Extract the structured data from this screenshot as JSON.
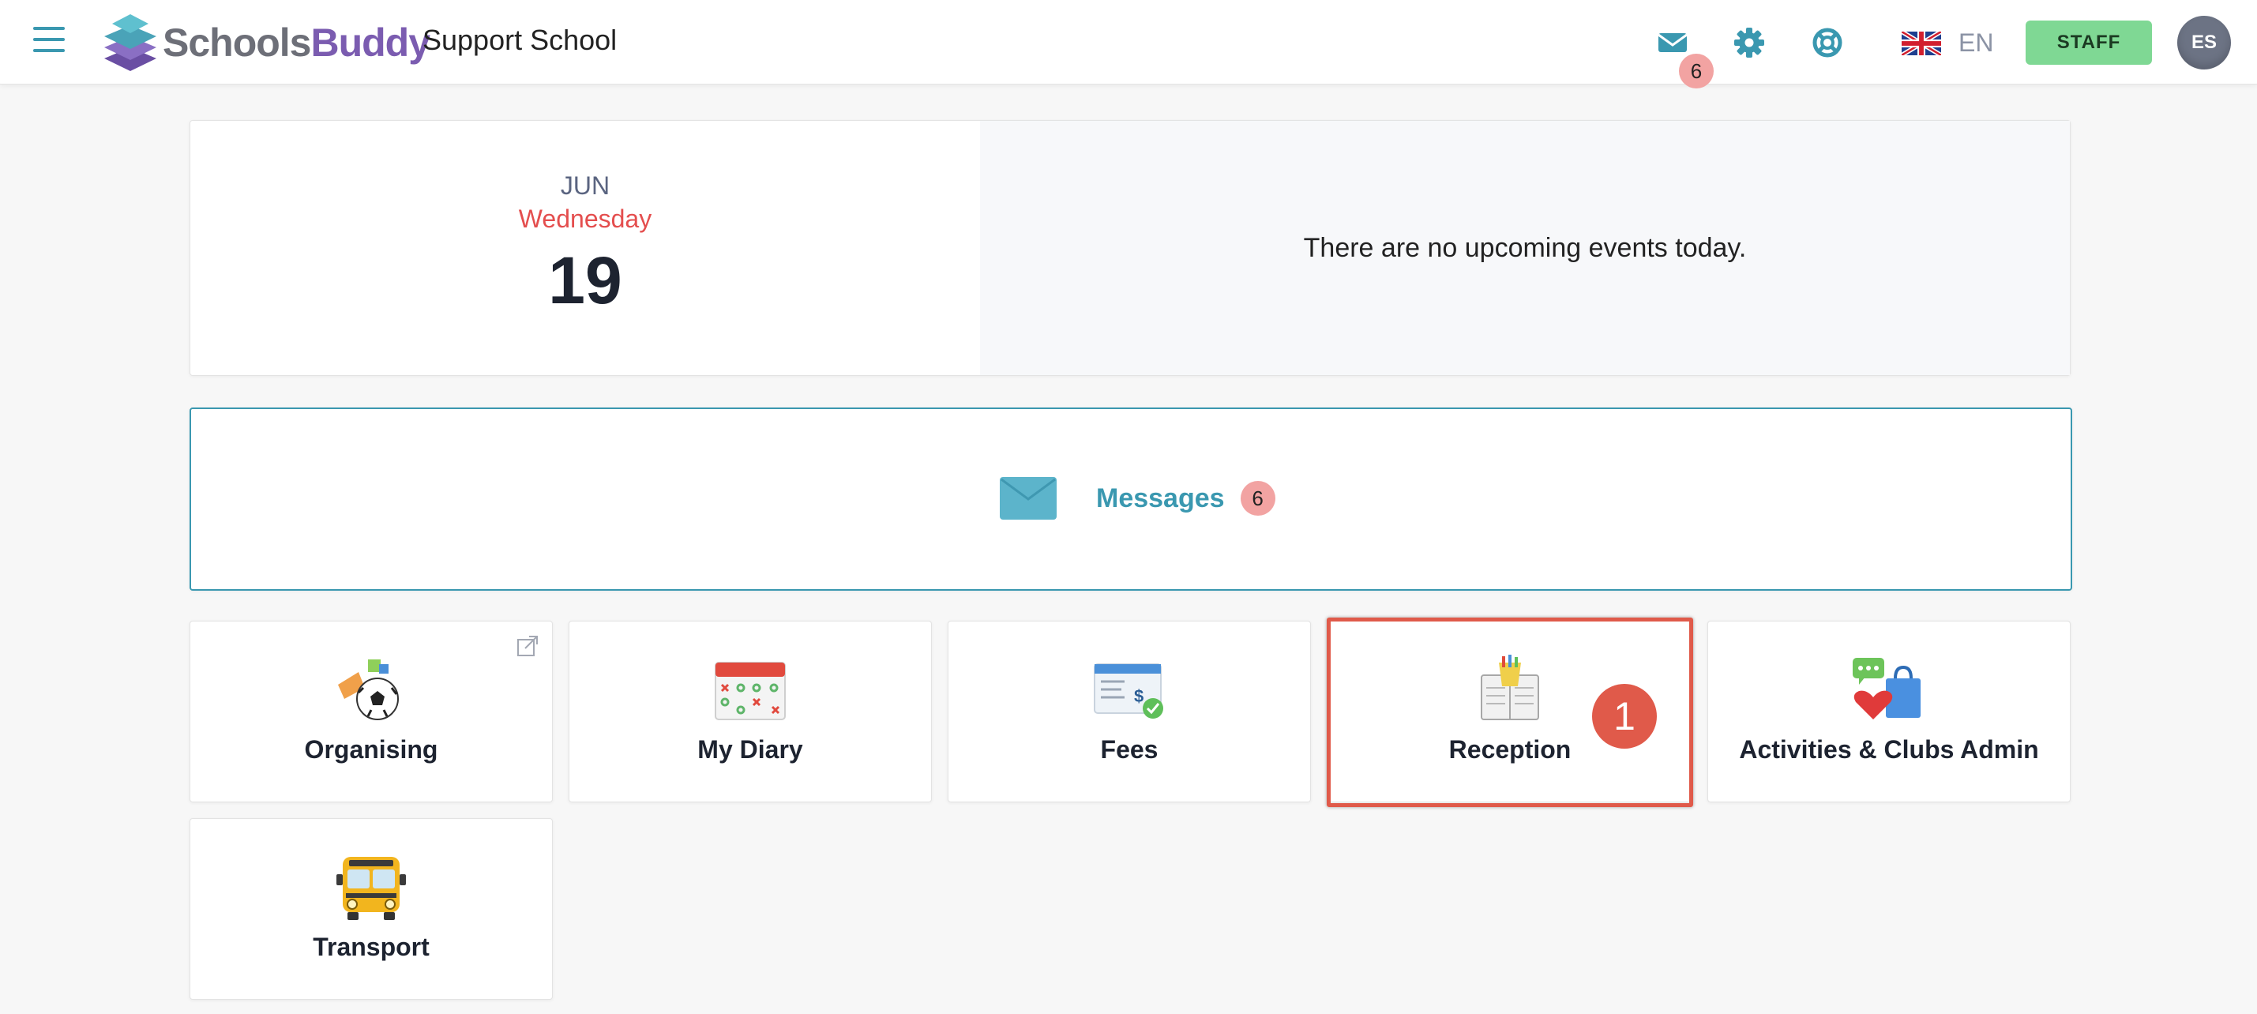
{
  "header": {
    "logo_text_a": "Schools",
    "logo_text_b": "Buddy",
    "school_name": "Support School",
    "mail_badge": "6",
    "language_code": "EN",
    "staff_label": "STAFF",
    "avatar_initials": "ES"
  },
  "date_panel": {
    "month": "JUN",
    "weekday": "Wednesday",
    "day": "19",
    "events_text": "There are no upcoming events today."
  },
  "messages": {
    "label": "Messages",
    "count": "6"
  },
  "tiles": [
    {
      "label": "Organising",
      "icon": "organising-icon"
    },
    {
      "label": "My Diary",
      "icon": "diary-calendar-icon"
    },
    {
      "label": "Fees",
      "icon": "fees-check-icon"
    },
    {
      "label": "Reception",
      "icon": "reception-book-icon"
    },
    {
      "label": "Activities & Clubs Admin",
      "icon": "activities-chat-shopping-icon"
    },
    {
      "label": "Transport",
      "icon": "school-bus-icon"
    }
  ],
  "annotation": {
    "step_number": "1"
  },
  "colors": {
    "accent": "#3a98b0",
    "brand_purple": "#7b5cb0",
    "staff_green": "#7fd894",
    "weekday_red": "#e44e4e",
    "badge_pink": "#f2a3a2",
    "highlight_red": "#e05a4a"
  }
}
